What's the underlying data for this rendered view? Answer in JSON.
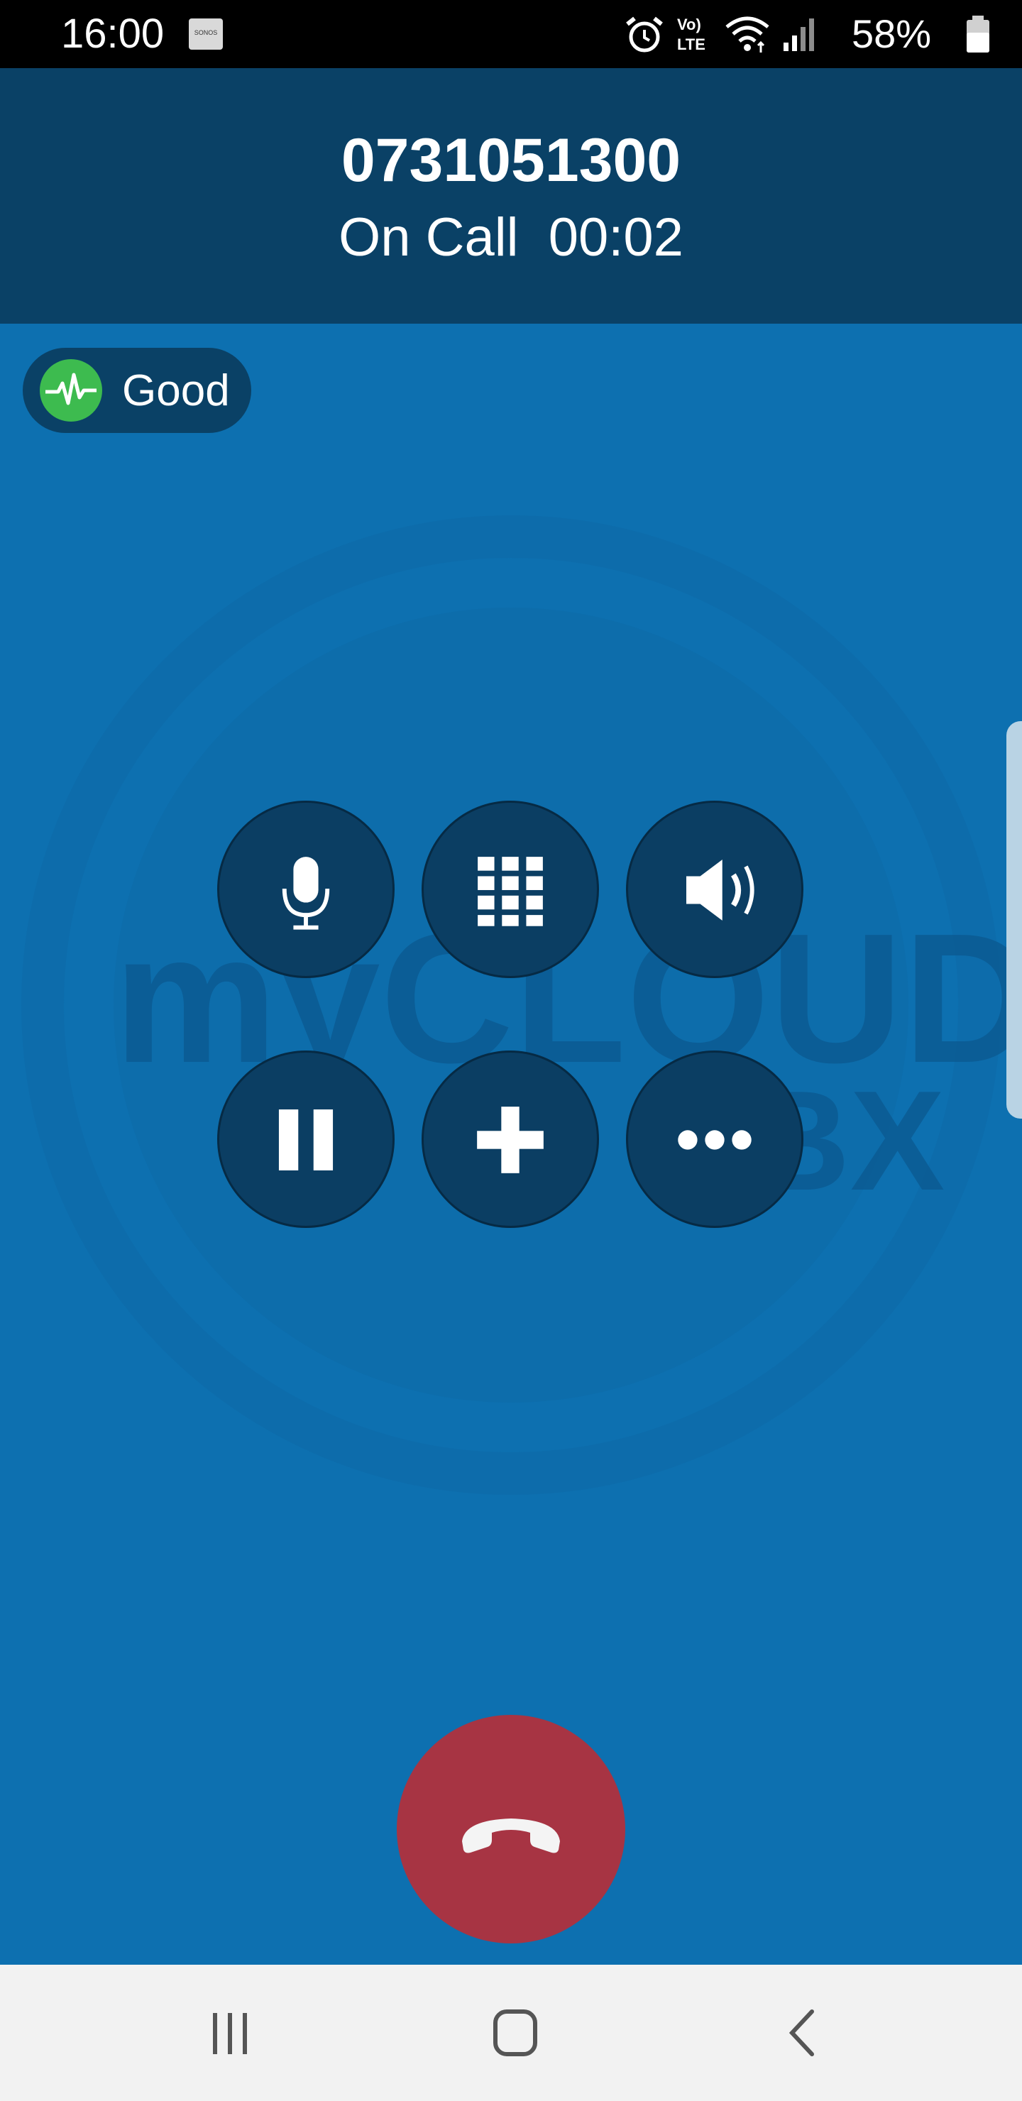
{
  "status_bar": {
    "time": "16:00",
    "sonos_label": "SONOS",
    "battery_percent": "58%",
    "icons": [
      "sonos-icon",
      "alarm-icon",
      "volte-icon",
      "wifi-icon",
      "signal-icon",
      "battery-icon"
    ]
  },
  "call": {
    "number": "0731051300",
    "status": "On Call  00:02"
  },
  "quality": {
    "label": "Good",
    "icon": "waveform-icon",
    "color": "#3dbb4f"
  },
  "controls": [
    {
      "name": "mute",
      "icon": "microphone-icon"
    },
    {
      "name": "keypad",
      "icon": "keypad-icon"
    },
    {
      "name": "speaker",
      "icon": "speaker-icon"
    },
    {
      "name": "hold",
      "icon": "pause-icon"
    },
    {
      "name": "add-call",
      "icon": "plus-icon"
    },
    {
      "name": "more",
      "icon": "more-icon"
    }
  ],
  "watermark": {
    "brand": "myCLOUD",
    "sub": "PBX"
  },
  "colors": {
    "header": "#0a4166",
    "background": "#0d70b0",
    "button": "#0b3e63",
    "hangup": "#a73443",
    "nav": "#f2f2f2"
  },
  "nav": {
    "items": [
      "recent-apps-icon",
      "home-icon",
      "back-icon"
    ]
  }
}
